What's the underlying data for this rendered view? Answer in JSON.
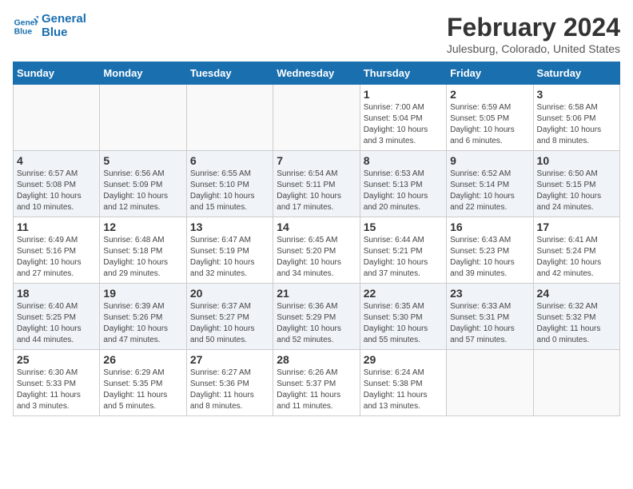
{
  "logo": {
    "line1": "General",
    "line2": "Blue"
  },
  "title": "February 2024",
  "subtitle": "Julesburg, Colorado, United States",
  "weekdays": [
    "Sunday",
    "Monday",
    "Tuesday",
    "Wednesday",
    "Thursday",
    "Friday",
    "Saturday"
  ],
  "weeks": [
    [
      {
        "day": "",
        "info": ""
      },
      {
        "day": "",
        "info": ""
      },
      {
        "day": "",
        "info": ""
      },
      {
        "day": "",
        "info": ""
      },
      {
        "day": "1",
        "info": "Sunrise: 7:00 AM\nSunset: 5:04 PM\nDaylight: 10 hours\nand 3 minutes."
      },
      {
        "day": "2",
        "info": "Sunrise: 6:59 AM\nSunset: 5:05 PM\nDaylight: 10 hours\nand 6 minutes."
      },
      {
        "day": "3",
        "info": "Sunrise: 6:58 AM\nSunset: 5:06 PM\nDaylight: 10 hours\nand 8 minutes."
      }
    ],
    [
      {
        "day": "4",
        "info": "Sunrise: 6:57 AM\nSunset: 5:08 PM\nDaylight: 10 hours\nand 10 minutes."
      },
      {
        "day": "5",
        "info": "Sunrise: 6:56 AM\nSunset: 5:09 PM\nDaylight: 10 hours\nand 12 minutes."
      },
      {
        "day": "6",
        "info": "Sunrise: 6:55 AM\nSunset: 5:10 PM\nDaylight: 10 hours\nand 15 minutes."
      },
      {
        "day": "7",
        "info": "Sunrise: 6:54 AM\nSunset: 5:11 PM\nDaylight: 10 hours\nand 17 minutes."
      },
      {
        "day": "8",
        "info": "Sunrise: 6:53 AM\nSunset: 5:13 PM\nDaylight: 10 hours\nand 20 minutes."
      },
      {
        "day": "9",
        "info": "Sunrise: 6:52 AM\nSunset: 5:14 PM\nDaylight: 10 hours\nand 22 minutes."
      },
      {
        "day": "10",
        "info": "Sunrise: 6:50 AM\nSunset: 5:15 PM\nDaylight: 10 hours\nand 24 minutes."
      }
    ],
    [
      {
        "day": "11",
        "info": "Sunrise: 6:49 AM\nSunset: 5:16 PM\nDaylight: 10 hours\nand 27 minutes."
      },
      {
        "day": "12",
        "info": "Sunrise: 6:48 AM\nSunset: 5:18 PM\nDaylight: 10 hours\nand 29 minutes."
      },
      {
        "day": "13",
        "info": "Sunrise: 6:47 AM\nSunset: 5:19 PM\nDaylight: 10 hours\nand 32 minutes."
      },
      {
        "day": "14",
        "info": "Sunrise: 6:45 AM\nSunset: 5:20 PM\nDaylight: 10 hours\nand 34 minutes."
      },
      {
        "day": "15",
        "info": "Sunrise: 6:44 AM\nSunset: 5:21 PM\nDaylight: 10 hours\nand 37 minutes."
      },
      {
        "day": "16",
        "info": "Sunrise: 6:43 AM\nSunset: 5:23 PM\nDaylight: 10 hours\nand 39 minutes."
      },
      {
        "day": "17",
        "info": "Sunrise: 6:41 AM\nSunset: 5:24 PM\nDaylight: 10 hours\nand 42 minutes."
      }
    ],
    [
      {
        "day": "18",
        "info": "Sunrise: 6:40 AM\nSunset: 5:25 PM\nDaylight: 10 hours\nand 44 minutes."
      },
      {
        "day": "19",
        "info": "Sunrise: 6:39 AM\nSunset: 5:26 PM\nDaylight: 10 hours\nand 47 minutes."
      },
      {
        "day": "20",
        "info": "Sunrise: 6:37 AM\nSunset: 5:27 PM\nDaylight: 10 hours\nand 50 minutes."
      },
      {
        "day": "21",
        "info": "Sunrise: 6:36 AM\nSunset: 5:29 PM\nDaylight: 10 hours\nand 52 minutes."
      },
      {
        "day": "22",
        "info": "Sunrise: 6:35 AM\nSunset: 5:30 PM\nDaylight: 10 hours\nand 55 minutes."
      },
      {
        "day": "23",
        "info": "Sunrise: 6:33 AM\nSunset: 5:31 PM\nDaylight: 10 hours\nand 57 minutes."
      },
      {
        "day": "24",
        "info": "Sunrise: 6:32 AM\nSunset: 5:32 PM\nDaylight: 11 hours\nand 0 minutes."
      }
    ],
    [
      {
        "day": "25",
        "info": "Sunrise: 6:30 AM\nSunset: 5:33 PM\nDaylight: 11 hours\nand 3 minutes."
      },
      {
        "day": "26",
        "info": "Sunrise: 6:29 AM\nSunset: 5:35 PM\nDaylight: 11 hours\nand 5 minutes."
      },
      {
        "day": "27",
        "info": "Sunrise: 6:27 AM\nSunset: 5:36 PM\nDaylight: 11 hours\nand 8 minutes."
      },
      {
        "day": "28",
        "info": "Sunrise: 6:26 AM\nSunset: 5:37 PM\nDaylight: 11 hours\nand 11 minutes."
      },
      {
        "day": "29",
        "info": "Sunrise: 6:24 AM\nSunset: 5:38 PM\nDaylight: 11 hours\nand 13 minutes."
      },
      {
        "day": "",
        "info": ""
      },
      {
        "day": "",
        "info": ""
      }
    ]
  ]
}
